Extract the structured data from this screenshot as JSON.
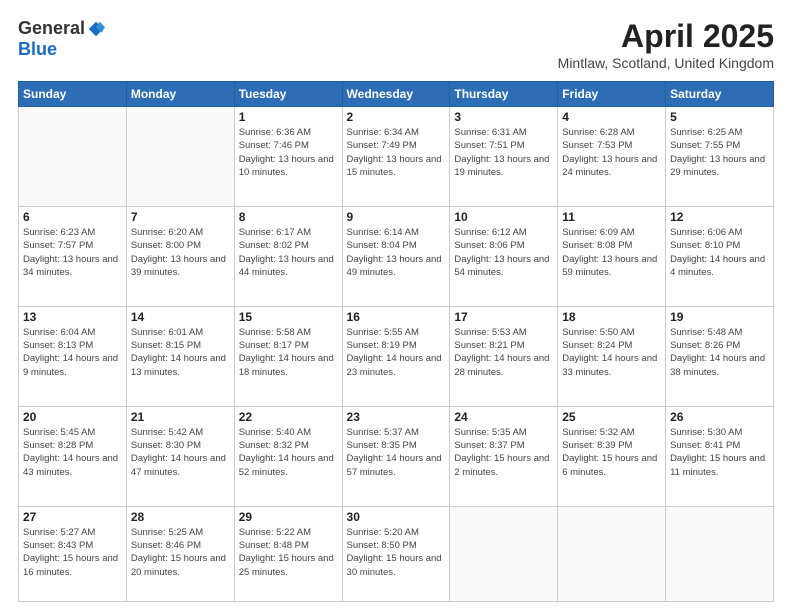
{
  "header": {
    "logo_general": "General",
    "logo_blue": "Blue",
    "title": "April 2025",
    "location": "Mintlaw, Scotland, United Kingdom"
  },
  "days_of_week": [
    "Sunday",
    "Monday",
    "Tuesday",
    "Wednesday",
    "Thursday",
    "Friday",
    "Saturday"
  ],
  "weeks": [
    [
      {
        "day": "",
        "info": ""
      },
      {
        "day": "",
        "info": ""
      },
      {
        "day": "1",
        "info": "Sunrise: 6:36 AM\nSunset: 7:46 PM\nDaylight: 13 hours and 10 minutes."
      },
      {
        "day": "2",
        "info": "Sunrise: 6:34 AM\nSunset: 7:49 PM\nDaylight: 13 hours and 15 minutes."
      },
      {
        "day": "3",
        "info": "Sunrise: 6:31 AM\nSunset: 7:51 PM\nDaylight: 13 hours and 19 minutes."
      },
      {
        "day": "4",
        "info": "Sunrise: 6:28 AM\nSunset: 7:53 PM\nDaylight: 13 hours and 24 minutes."
      },
      {
        "day": "5",
        "info": "Sunrise: 6:25 AM\nSunset: 7:55 PM\nDaylight: 13 hours and 29 minutes."
      }
    ],
    [
      {
        "day": "6",
        "info": "Sunrise: 6:23 AM\nSunset: 7:57 PM\nDaylight: 13 hours and 34 minutes."
      },
      {
        "day": "7",
        "info": "Sunrise: 6:20 AM\nSunset: 8:00 PM\nDaylight: 13 hours and 39 minutes."
      },
      {
        "day": "8",
        "info": "Sunrise: 6:17 AM\nSunset: 8:02 PM\nDaylight: 13 hours and 44 minutes."
      },
      {
        "day": "9",
        "info": "Sunrise: 6:14 AM\nSunset: 8:04 PM\nDaylight: 13 hours and 49 minutes."
      },
      {
        "day": "10",
        "info": "Sunrise: 6:12 AM\nSunset: 8:06 PM\nDaylight: 13 hours and 54 minutes."
      },
      {
        "day": "11",
        "info": "Sunrise: 6:09 AM\nSunset: 8:08 PM\nDaylight: 13 hours and 59 minutes."
      },
      {
        "day": "12",
        "info": "Sunrise: 6:06 AM\nSunset: 8:10 PM\nDaylight: 14 hours and 4 minutes."
      }
    ],
    [
      {
        "day": "13",
        "info": "Sunrise: 6:04 AM\nSunset: 8:13 PM\nDaylight: 14 hours and 9 minutes."
      },
      {
        "day": "14",
        "info": "Sunrise: 6:01 AM\nSunset: 8:15 PM\nDaylight: 14 hours and 13 minutes."
      },
      {
        "day": "15",
        "info": "Sunrise: 5:58 AM\nSunset: 8:17 PM\nDaylight: 14 hours and 18 minutes."
      },
      {
        "day": "16",
        "info": "Sunrise: 5:55 AM\nSunset: 8:19 PM\nDaylight: 14 hours and 23 minutes."
      },
      {
        "day": "17",
        "info": "Sunrise: 5:53 AM\nSunset: 8:21 PM\nDaylight: 14 hours and 28 minutes."
      },
      {
        "day": "18",
        "info": "Sunrise: 5:50 AM\nSunset: 8:24 PM\nDaylight: 14 hours and 33 minutes."
      },
      {
        "day": "19",
        "info": "Sunrise: 5:48 AM\nSunset: 8:26 PM\nDaylight: 14 hours and 38 minutes."
      }
    ],
    [
      {
        "day": "20",
        "info": "Sunrise: 5:45 AM\nSunset: 8:28 PM\nDaylight: 14 hours and 43 minutes."
      },
      {
        "day": "21",
        "info": "Sunrise: 5:42 AM\nSunset: 8:30 PM\nDaylight: 14 hours and 47 minutes."
      },
      {
        "day": "22",
        "info": "Sunrise: 5:40 AM\nSunset: 8:32 PM\nDaylight: 14 hours and 52 minutes."
      },
      {
        "day": "23",
        "info": "Sunrise: 5:37 AM\nSunset: 8:35 PM\nDaylight: 14 hours and 57 minutes."
      },
      {
        "day": "24",
        "info": "Sunrise: 5:35 AM\nSunset: 8:37 PM\nDaylight: 15 hours and 2 minutes."
      },
      {
        "day": "25",
        "info": "Sunrise: 5:32 AM\nSunset: 8:39 PM\nDaylight: 15 hours and 6 minutes."
      },
      {
        "day": "26",
        "info": "Sunrise: 5:30 AM\nSunset: 8:41 PM\nDaylight: 15 hours and 11 minutes."
      }
    ],
    [
      {
        "day": "27",
        "info": "Sunrise: 5:27 AM\nSunset: 8:43 PM\nDaylight: 15 hours and 16 minutes."
      },
      {
        "day": "28",
        "info": "Sunrise: 5:25 AM\nSunset: 8:46 PM\nDaylight: 15 hours and 20 minutes."
      },
      {
        "day": "29",
        "info": "Sunrise: 5:22 AM\nSunset: 8:48 PM\nDaylight: 15 hours and 25 minutes."
      },
      {
        "day": "30",
        "info": "Sunrise: 5:20 AM\nSunset: 8:50 PM\nDaylight: 15 hours and 30 minutes."
      },
      {
        "day": "",
        "info": ""
      },
      {
        "day": "",
        "info": ""
      },
      {
        "day": "",
        "info": ""
      }
    ]
  ]
}
